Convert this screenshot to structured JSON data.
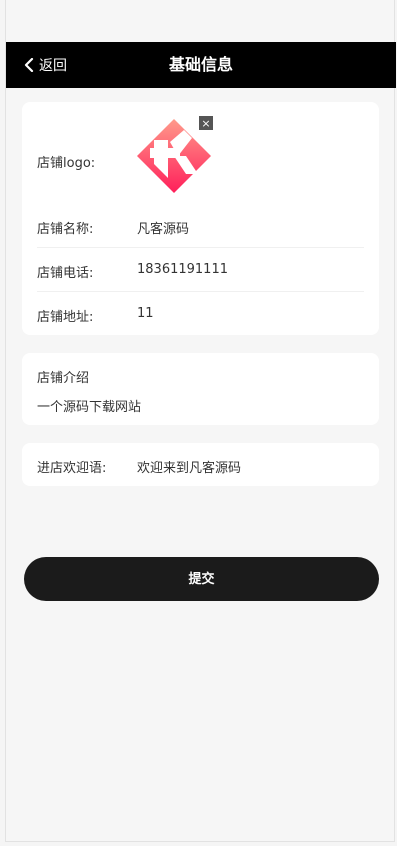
{
  "header": {
    "back_label": "返回",
    "title": "基础信息"
  },
  "shop_info": {
    "logo_label": "店铺logo:",
    "logo_close": "×",
    "name_label": "店铺名称:",
    "name_value": "凡客源码",
    "phone_label": "店铺电话:",
    "phone_value": "18361191111",
    "address_label": "店铺地址:",
    "address_value": "11"
  },
  "intro": {
    "title": "店铺介绍",
    "text": "一个源码下载网站"
  },
  "welcome": {
    "label": "进店欢迎语:",
    "value": "欢迎来到凡客源码"
  },
  "actions": {
    "submit_label": "提交"
  },
  "colors": {
    "header_bg": "#000000",
    "logo_gradient_top": "#ff8a80",
    "logo_gradient_bottom": "#ff1f5a",
    "button_bg": "#1b1b1b"
  },
  "icons": {
    "back": "chevron-left-icon",
    "logo_close": "close-icon"
  }
}
